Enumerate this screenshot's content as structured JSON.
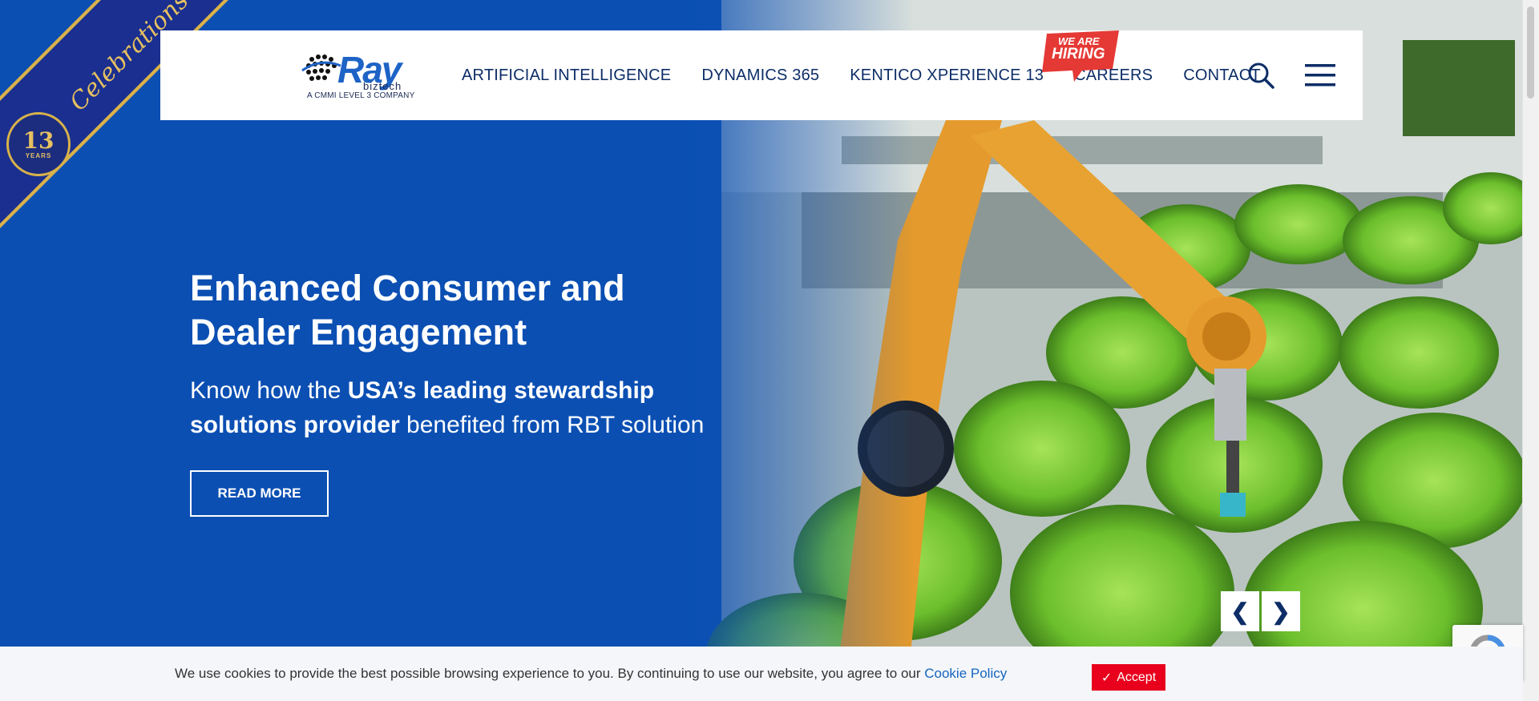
{
  "header": {
    "logo_text": "Ray",
    "logo_sub": "biztech",
    "logo_tagline": "A CMMI LEVEL 3 COMPANY",
    "nav": [
      {
        "label": "ARTIFICIAL INTELLIGENCE"
      },
      {
        "label": "DYNAMICS 365"
      },
      {
        "label": "KENTICO XPERIENCE 13"
      },
      {
        "label": "CAREERS"
      },
      {
        "label": "CONTACT"
      }
    ],
    "hiring_badge_line1": "WE ARE",
    "hiring_badge_line2": "HIRING",
    "icons": {
      "search": "search-icon",
      "menu": "hamburger-menu-icon"
    }
  },
  "ribbon": {
    "text": "Celebrations",
    "badge_number": "13",
    "badge_sub": "YEARS"
  },
  "hero": {
    "title": "Enhanced Consumer and Dealer Engagement",
    "subtitle_pre": "Know how the ",
    "subtitle_bold": "USA’s leading stewardship solutions provider",
    "subtitle_post": " benefited from RBT solution",
    "cta_label": "READ MORE",
    "prev_label": "❮",
    "next_label": "❯"
  },
  "cookie": {
    "message": "We use cookies to provide the best possible browsing experience to you. By continuing to use our website, you agree to our ",
    "link_text": "Cookie Policy",
    "accept_label": "Accept",
    "accept_icon": "✓"
  },
  "colors": {
    "hero_blue": "#0b4fb3",
    "nav_text": "#0d2d66",
    "accept_red": "#e8001c",
    "link_blue": "#1565c0"
  }
}
